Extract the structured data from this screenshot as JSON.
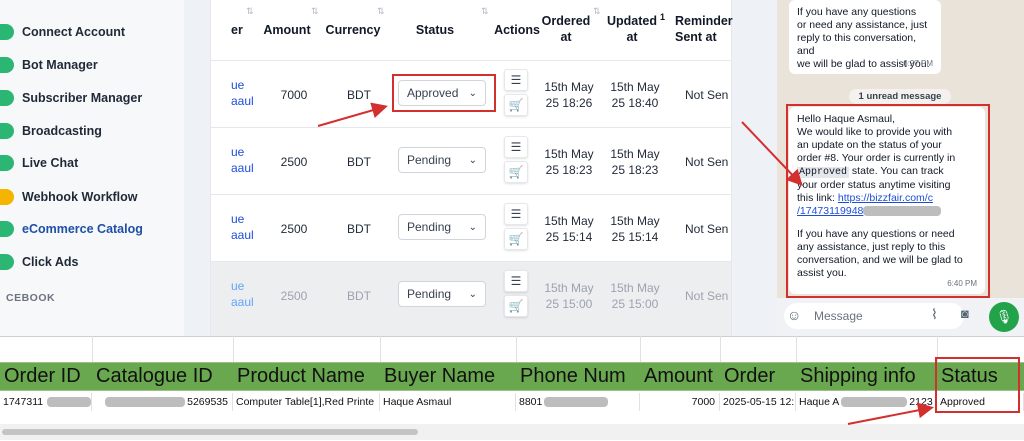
{
  "sidebar": {
    "items": [
      {
        "label": "Connect Account",
        "color": "#2bb673"
      },
      {
        "label": "Bot Manager",
        "color": "#2bb673"
      },
      {
        "label": "Subscriber Manager",
        "color": "#2bb673"
      },
      {
        "label": "Broadcasting",
        "color": "#2bb673"
      },
      {
        "label": "Live Chat",
        "color": "#2bb673"
      },
      {
        "label": "Webhook Workflow",
        "color": "#f4b400"
      },
      {
        "label": "eCommerce Catalog",
        "color": "#2bb673"
      },
      {
        "label": "Click Ads",
        "color": "#2bb673"
      }
    ],
    "section": "CEBOOK",
    "active_index": 6
  },
  "orders_table": {
    "headers": {
      "buyer": "er",
      "amount": "Amount",
      "currency": "Currency",
      "status": "Status",
      "actions": "Actions",
      "ordered_at_1": "Ordered",
      "ordered_at_2": "at",
      "updated_at_1": "Updated",
      "updated_at_2": "at",
      "updated_sort": "1",
      "reminder_1": "Reminder",
      "reminder_2": "Sent at"
    },
    "rows": [
      {
        "buyer_1": "ue",
        "buyer_2": "aaul",
        "amount": "7000",
        "currency": "BDT",
        "status": "Approved",
        "ordered_1": "15th May",
        "ordered_2": "25 18:26",
        "updated_1": "15th May",
        "updated_2": "25 18:40",
        "reminder": "Not Sen"
      },
      {
        "buyer_1": "ue",
        "buyer_2": "aaul",
        "amount": "2500",
        "currency": "BDT",
        "status": "Pending",
        "ordered_1": "15th May",
        "ordered_2": "25 18:23",
        "updated_1": "15th May",
        "updated_2": "25 18:23",
        "reminder": "Not Sen"
      },
      {
        "buyer_1": "ue",
        "buyer_2": "aaul",
        "amount": "2500",
        "currency": "BDT",
        "status": "Pending",
        "ordered_1": "15th May",
        "ordered_2": "25 15:14",
        "updated_1": "15th May",
        "updated_2": "25 15:14",
        "reminder": "Not Sen"
      },
      {
        "buyer_1": "ue",
        "buyer_2": "aaul",
        "amount": "2500",
        "currency": "BDT",
        "status": "Pending",
        "ordered_1": "15th May",
        "ordered_2": "25 15:00",
        "updated_1": "15th May",
        "updated_2": "25 15:00",
        "reminder": "Not Sen"
      }
    ]
  },
  "chat": {
    "prev_lines": [
      "If you have any questions",
      "or need any assistance, just",
      "reply to this conversation, and",
      "we will be glad to assist you."
    ],
    "prev_time": "6:27 PM",
    "unread_label": "1 unread message",
    "msg": {
      "l1": "Hello Haque Asmaul,",
      "l2": "We would like to provide you with",
      "l3": "an update on the status of your",
      "l4": "order #8. Your order is currently in",
      "code": "Approved",
      "l5b": " state. You can track",
      "l6": "your order status anytime visiting",
      "l7": "this link: ",
      "link1": "https://bizzfair.com/c",
      "link2": "/17473119948",
      "l8": "If you have any questions or need",
      "l9": "any assistance, just reply to this",
      "l10": "conversation, and we will be glad to",
      "l11": "assist you.",
      "time": "6:40 PM"
    },
    "input_placeholder": "Message"
  },
  "sheet": {
    "headers": [
      "Order ID",
      "Catalogue ID",
      "Product Name",
      "Buyer Name",
      "Phone Num",
      "Amount",
      "Order",
      "Shipping info",
      "Status"
    ],
    "row": {
      "order_id": "1747311",
      "catalogue_id": "5269535",
      "product_name": "Computer Table[1],Red Printe",
      "buyer_name": "Haque Asmaul",
      "phone": "8801",
      "amount": "7000",
      "order": "2025-05-15 12:",
      "shipping_a": "Haque A",
      "shipping_b": "2123",
      "status": "Approved"
    }
  },
  "colors": {
    "highlight": "#d32f2f",
    "sheet_header": "#6aa84f",
    "link": "#1d4ed8",
    "whatsapp_green": "#22a34a"
  }
}
